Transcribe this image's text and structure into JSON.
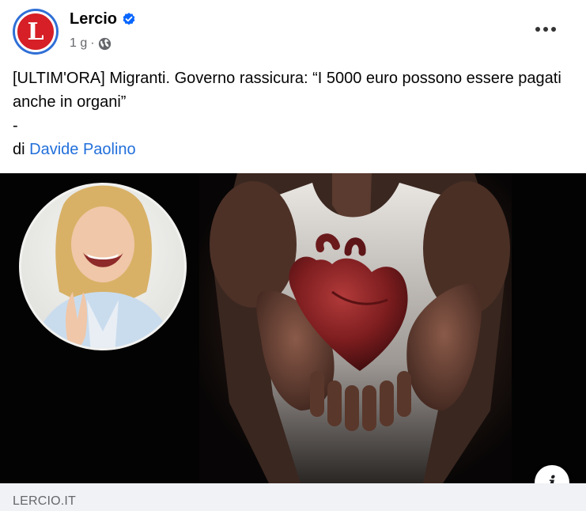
{
  "page": {
    "name": "Lercio",
    "avatar_letter": "L",
    "verified": true,
    "timestamp": "1 g",
    "separator": "·",
    "audience_icon": "globe-icon"
  },
  "post": {
    "text_line": "[ULTIM'ORA] Migranti. Governo rassicura: “I 5000 euro possono essere pagati anche in organi”",
    "dash": "-",
    "byline_prefix": "di",
    "author": "Davide Paolino"
  },
  "link_preview": {
    "domain": "LERCIO.IT",
    "info_icon": "i"
  },
  "colors": {
    "brand_red": "#d61f26",
    "link_blue": "#216fdb",
    "verified_blue": "#0866ff",
    "muted_text": "#65676b",
    "footer_bg": "#f0f2f5"
  }
}
